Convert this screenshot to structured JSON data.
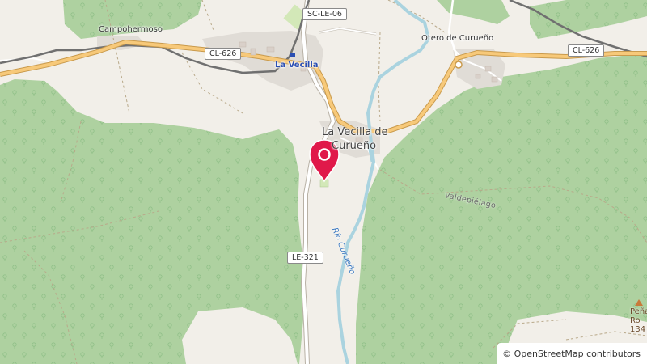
{
  "map": {
    "places": {
      "campohermoso": "Campohermoso",
      "otero": "Otero de Curueño",
      "vecilla_station": "La Vecilla",
      "vecilla_de_curueno_1": "La Vecilla de",
      "vecilla_de_curueno_2": "Curueño",
      "valdepielago": "Valdepiélago",
      "pena_1": "Peña",
      "pena_2": "Ro",
      "pena_3": "134"
    },
    "roads": {
      "cl626_west": "CL-626",
      "cl626_east": "CL-626",
      "scle06": "SC-LE-06",
      "le321": "LE-321"
    },
    "river": "Río Curueño",
    "attribution": "© OpenStreetMap contributors",
    "colors": {
      "forest": "#aed1a0",
      "land": "#f2efe9",
      "road_secondary": "#f7c97a",
      "road_casing": "#c99a4c",
      "water": "#aad3df",
      "railway": "#707070",
      "marker": "#e0194a"
    }
  }
}
